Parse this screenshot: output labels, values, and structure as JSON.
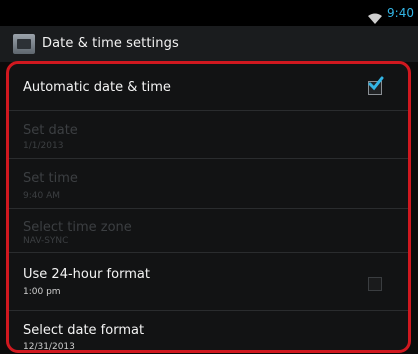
{
  "status_bar": {
    "time": "9:40"
  },
  "title_bar": {
    "title": "Date & time settings"
  },
  "settings": {
    "automatic": {
      "label": "Automatic date & time",
      "checked": true
    },
    "set_date": {
      "label": "Set date",
      "value": "1/1/2013",
      "enabled": false
    },
    "set_time": {
      "label": "Set time",
      "value": "9:40 AM",
      "enabled": false
    },
    "time_zone": {
      "label": "Select time zone",
      "value": "NAV-SYNC",
      "enabled": false
    },
    "hour24": {
      "label": "Use 24-hour format",
      "value": "1:00 pm",
      "checked": false
    },
    "date_format": {
      "label": "Select date format",
      "value": "12/31/2013"
    }
  },
  "colors": {
    "accent": "#33b5e5",
    "highlight_border": "#d0181f"
  }
}
